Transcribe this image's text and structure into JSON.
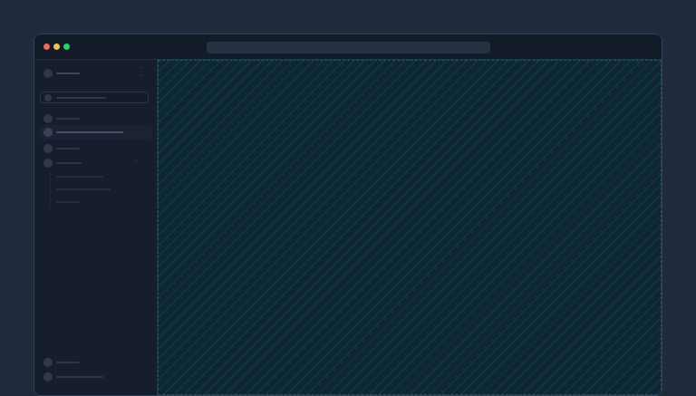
{
  "window": {
    "dot_colors": {
      "close": "#ed6a5e",
      "minimize": "#f5bf4f",
      "maximize": "#2fd06a"
    }
  },
  "colors": {
    "page_background": "#1f2a3c",
    "sidebar": "#161d2d",
    "canvas": "#0d2734"
  },
  "icons": {
    "workspace": "avatar-icon",
    "switcher": "chevron-up-down-icon",
    "search": "search-icon",
    "expand": "chevron-up-icon"
  }
}
